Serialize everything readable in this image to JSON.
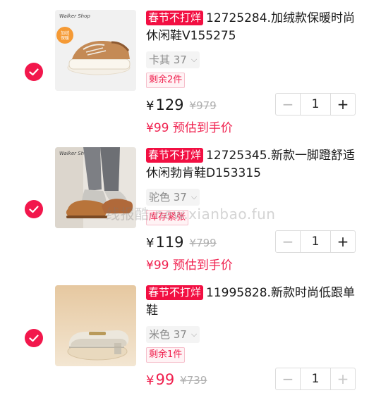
{
  "colors": {
    "accent": "#f2174c",
    "price_red": "#f0204e"
  },
  "items": [
    {
      "tag": "春节不打烊",
      "title": "12725284.加绒款保暖时尚休闲鞋V155275",
      "spec": "卡其 37",
      "badge": "剩余2件",
      "price": "129",
      "currency": "¥",
      "old_price": "¥979",
      "quantity": "1",
      "estimate": "¥99 预估到手价",
      "brand_logo": "Walker Shop",
      "thumb_badge": "加绒保暖"
    },
    {
      "tag": "春节不打烊",
      "title": "12725345.新款一脚蹬舒适休闲勃肯鞋D153315",
      "spec": "驼色 37",
      "badge": "库存紧张",
      "price": "119",
      "currency": "¥",
      "old_price": "¥799",
      "quantity": "1",
      "estimate": "¥99 预估到手价",
      "brand_logo": "Walker Shop"
    },
    {
      "tag": "春节不打烊",
      "title": "11995828.新款时尚低跟单鞋",
      "spec": "米色 37",
      "badge": "剩余1件",
      "price": "99",
      "currency": "¥",
      "old_price": "¥739",
      "quantity": "1",
      "estimate": ""
    }
  ],
  "icons": {
    "check": "check-icon",
    "minus": "minus-icon",
    "plus": "plus-icon",
    "chevron": "chevron-down-icon"
  },
  "watermark": "线报酷-new.xianbao.fun"
}
